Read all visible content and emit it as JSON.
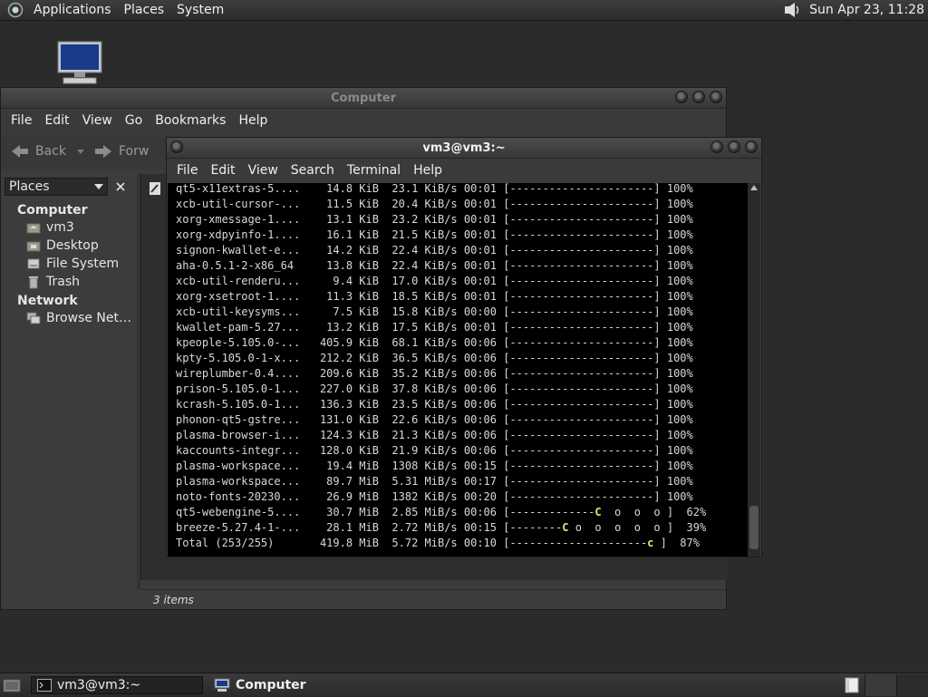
{
  "top_panel": {
    "menus": [
      "Applications",
      "Places",
      "System"
    ],
    "clock": "Sun Apr 23, 11:28",
    "volume_icon": "speaker-icon"
  },
  "file_manager": {
    "title": "Computer",
    "menus": [
      "File",
      "Edit",
      "View",
      "Go",
      "Bookmarks",
      "Help"
    ],
    "toolbar": {
      "back": "Back",
      "forward": "Forw"
    },
    "places_label": "Places",
    "sidebar": {
      "sections": [
        {
          "title": "Computer",
          "items": [
            {
              "label": "vm3",
              "icon": "home-folder-icon"
            },
            {
              "label": "Desktop",
              "icon": "desktop-folder-icon"
            },
            {
              "label": "File System",
              "icon": "drive-icon"
            },
            {
              "label": "Trash",
              "icon": "trash-icon"
            }
          ]
        },
        {
          "title": "Network",
          "items": [
            {
              "label": "Browse Net…",
              "icon": "network-icon"
            }
          ]
        }
      ]
    },
    "status": "3 items"
  },
  "terminal": {
    "title": "vm3@vm3:~",
    "menus": [
      "File",
      "Edit",
      "View",
      "Search",
      "Terminal",
      "Help"
    ],
    "lines": [
      "qt5-x11extras-5....    14.8 KiB  23.1 KiB/s 00:01 [----------------------] 100%",
      "xcb-util-cursor-...    11.5 KiB  20.4 KiB/s 00:01 [----------------------] 100%",
      "xorg-xmessage-1....    13.1 KiB  23.2 KiB/s 00:01 [----------------------] 100%",
      "xorg-xdpyinfo-1....    16.1 KiB  21.5 KiB/s 00:01 [----------------------] 100%",
      "signon-kwallet-e...    14.2 KiB  22.4 KiB/s 00:01 [----------------------] 100%",
      "aha-0.5.1-2-x86_64     13.8 KiB  22.4 KiB/s 00:01 [----------------------] 100%",
      "xcb-util-renderu...     9.4 KiB  17.0 KiB/s 00:01 [----------------------] 100%",
      "xorg-xsetroot-1....    11.3 KiB  18.5 KiB/s 00:01 [----------------------] 100%",
      "xcb-util-keysyms...     7.5 KiB  15.8 KiB/s 00:00 [----------------------] 100%",
      "kwallet-pam-5.27...    13.2 KiB  17.5 KiB/s 00:01 [----------------------] 100%",
      "kpeople-5.105.0-...   405.9 KiB  68.1 KiB/s 00:06 [----------------------] 100%",
      "kpty-5.105.0-1-x...   212.2 KiB  36.5 KiB/s 00:06 [----------------------] 100%",
      "wireplumber-0.4....   209.6 KiB  35.2 KiB/s 00:06 [----------------------] 100%",
      "prison-5.105.0-1...   227.0 KiB  37.8 KiB/s 00:06 [----------------------] 100%",
      "kcrash-5.105.0-1...   136.3 KiB  23.5 KiB/s 00:06 [----------------------] 100%",
      "phonon-qt5-gstre...   131.0 KiB  22.6 KiB/s 00:06 [----------------------] 100%",
      "plasma-browser-i...   124.3 KiB  21.3 KiB/s 00:06 [----------------------] 100%",
      "kaccounts-integr...   128.0 KiB  21.9 KiB/s 00:06 [----------------------] 100%",
      "plasma-workspace...    19.4 MiB  1308 KiB/s 00:15 [----------------------] 100%",
      "plasma-workspace...    89.7 MiB  5.31 MiB/s 00:17 [----------------------] 100%",
      "noto-fonts-20230...    26.9 MiB  1382 KiB/s 00:20 [----------------------] 100%"
    ],
    "progress_lines": [
      {
        "prefix": "qt5-webengine-5....    30.7 MiB  2.85 MiB/s 00:06 [-------------",
        "pac": "C",
        "suffix": "  o  o  o ]  62%"
      },
      {
        "prefix": "breeze-5.27.4-1-...    28.1 MiB  2.72 MiB/s 00:15 [--------",
        "pac": "C",
        "suffix": " o  o  o  o  o ]  39%"
      },
      {
        "prefix": "Total (253/255)       419.8 MiB  5.72 MiB/s 00:10 [---------------------",
        "pac": "c",
        "suffix": " ]  87%"
      }
    ]
  },
  "taskbar": {
    "tasks": [
      {
        "label": "vm3@vm3:~",
        "icon": "terminal-icon"
      },
      {
        "label": "Computer",
        "icon": "computer-icon"
      }
    ]
  }
}
